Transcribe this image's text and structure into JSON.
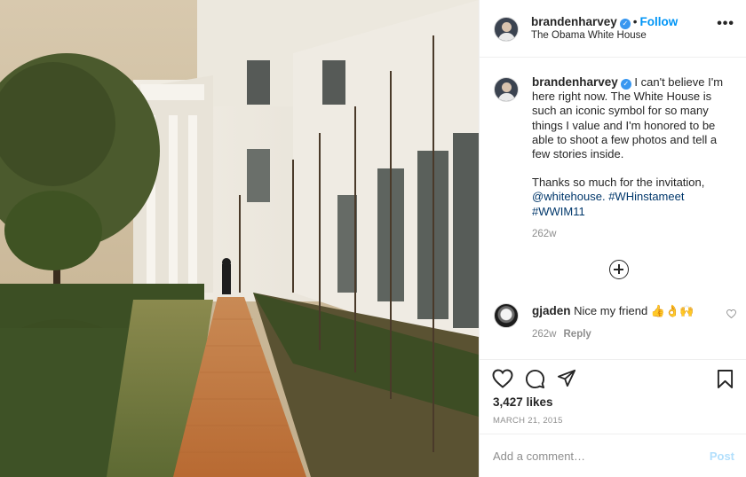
{
  "header": {
    "username": "brandenharvey",
    "verified_mark": "✓",
    "separator": "•",
    "follow_label": "Follow",
    "location": "The Obama White House",
    "more_icon": "•••"
  },
  "caption": {
    "username": "brandenharvey",
    "text_1": "I can't believe I'm here right now. The White House is such an iconic symbol for so many things I value and I'm honored to be able to shoot a few photos and tell a few stories inside.",
    "text_2": "Thanks so much for the invitation,",
    "mention": "@whitehouse.",
    "tag_1": "#WHinstameet",
    "tag_2": "#WWIM11",
    "age": "262w"
  },
  "comment": {
    "username": "gjaden",
    "text": "Nice my friend 👍👌🙌",
    "age": "262w",
    "reply_label": "Reply"
  },
  "stats": {
    "likes": "3,427 likes",
    "date": "MARCH 21, 2015"
  },
  "composer": {
    "placeholder": "Add a comment…",
    "post_label": "Post"
  },
  "icons": {
    "like": "heart-icon",
    "comment": "comment-icon",
    "share": "share-icon",
    "save": "bookmark-icon",
    "load_more": "plus-circle-icon"
  },
  "colors": {
    "accent": "#0095f6",
    "verified": "#3897f0",
    "link": "#00376b",
    "muted": "#8e8e8e",
    "post_disabled": "#b2dffc"
  }
}
